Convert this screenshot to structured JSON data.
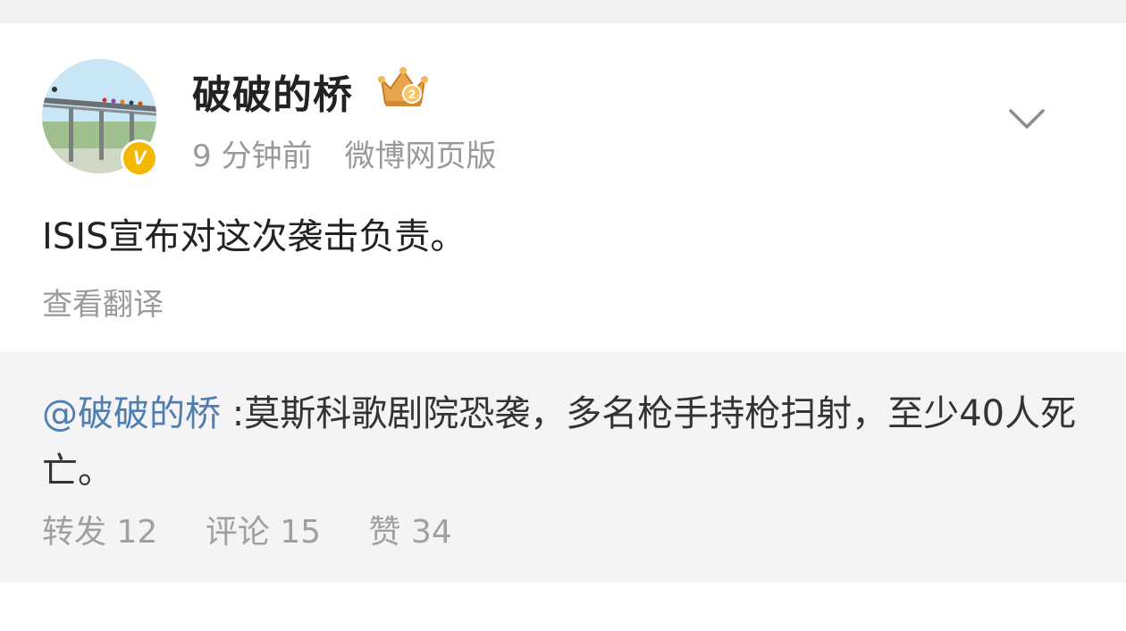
{
  "post": {
    "user_name": "破破的桥",
    "verified_badge": "V",
    "time": "9 分钟前",
    "source": "微博网页版",
    "text": "ISIS宣布对这次袭击负责。",
    "translate_label": "查看翻译"
  },
  "repost": {
    "mention": "@破破的桥",
    "text": " :莫斯科歌剧院恐袭，多名枪手持枪扫射，至少40人死亡。",
    "stats": {
      "repost_label": "转发",
      "repost_count": "12",
      "comment_label": "评论",
      "comment_count": "15",
      "like_label": "赞",
      "like_count": "34"
    }
  },
  "colors": {
    "background": "#ffffff",
    "repost_background": "#f4f4f6",
    "mention": "#4f7eaf",
    "muted_text": "#999999",
    "verified_badge": "#f5b800"
  },
  "icons": {
    "verified": "verified-v-icon",
    "member_crown": "member-crown-icon",
    "expand": "chevron-down-icon"
  }
}
